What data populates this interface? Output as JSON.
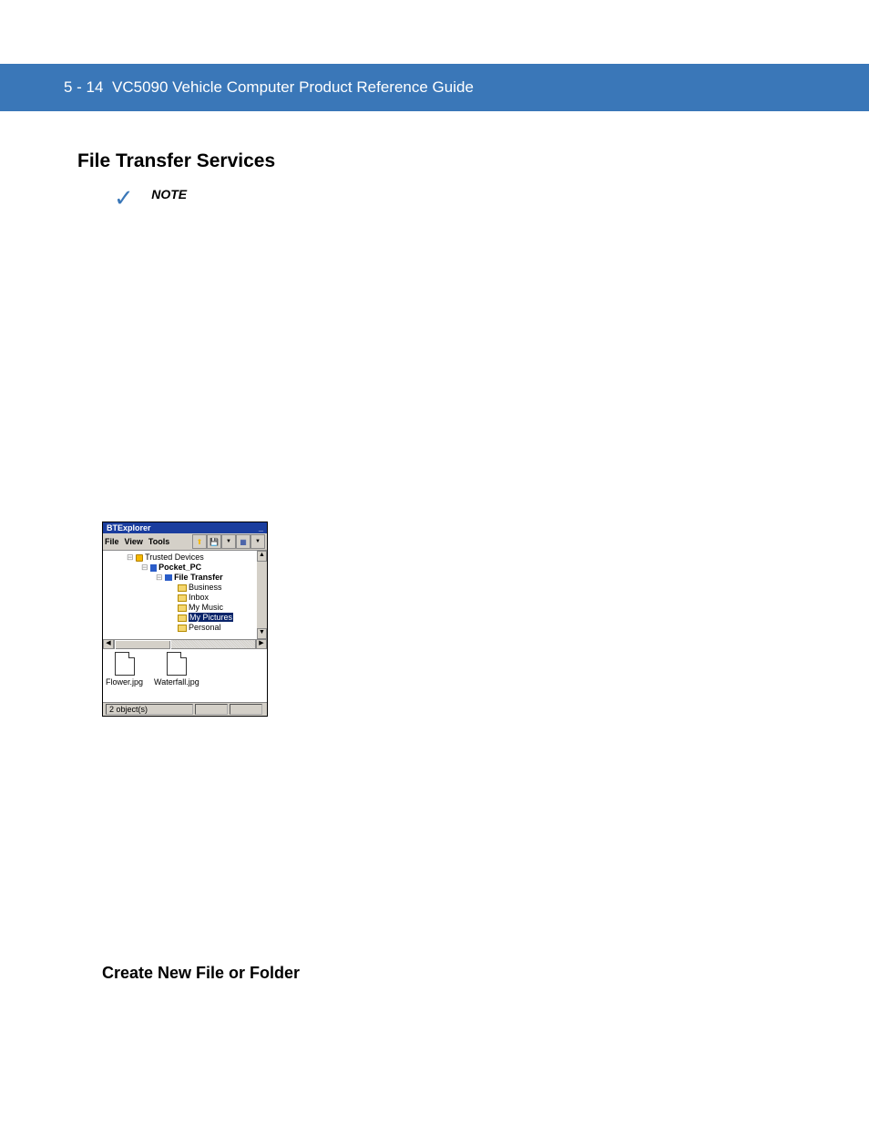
{
  "header": {
    "page_number": "5 - 14",
    "title": "VC5090 Vehicle Computer Product Reference Guide"
  },
  "section_heading": "File Transfer Services",
  "note_label": "NOTE",
  "screenshot": {
    "window_title": "BTExplorer",
    "titlebar_action": "_",
    "menus": [
      "File",
      "View",
      "Tools"
    ],
    "tree": {
      "root": {
        "label": "Trusted Devices",
        "children": [
          {
            "label": "Pocket_PC",
            "children": [
              {
                "label": "File Transfer",
                "children": [
                  {
                    "label": "Business"
                  },
                  {
                    "label": "Inbox"
                  },
                  {
                    "label": "My Music"
                  },
                  {
                    "label": "My Pictures",
                    "selected": true
                  },
                  {
                    "label": "Personal"
                  }
                ]
              }
            ]
          }
        ]
      }
    },
    "files": [
      {
        "name": "Flower.jpg"
      },
      {
        "name": "Waterfall.jpg"
      }
    ],
    "status": "2 object(s)"
  },
  "sub_heading": "Create New File or Folder"
}
